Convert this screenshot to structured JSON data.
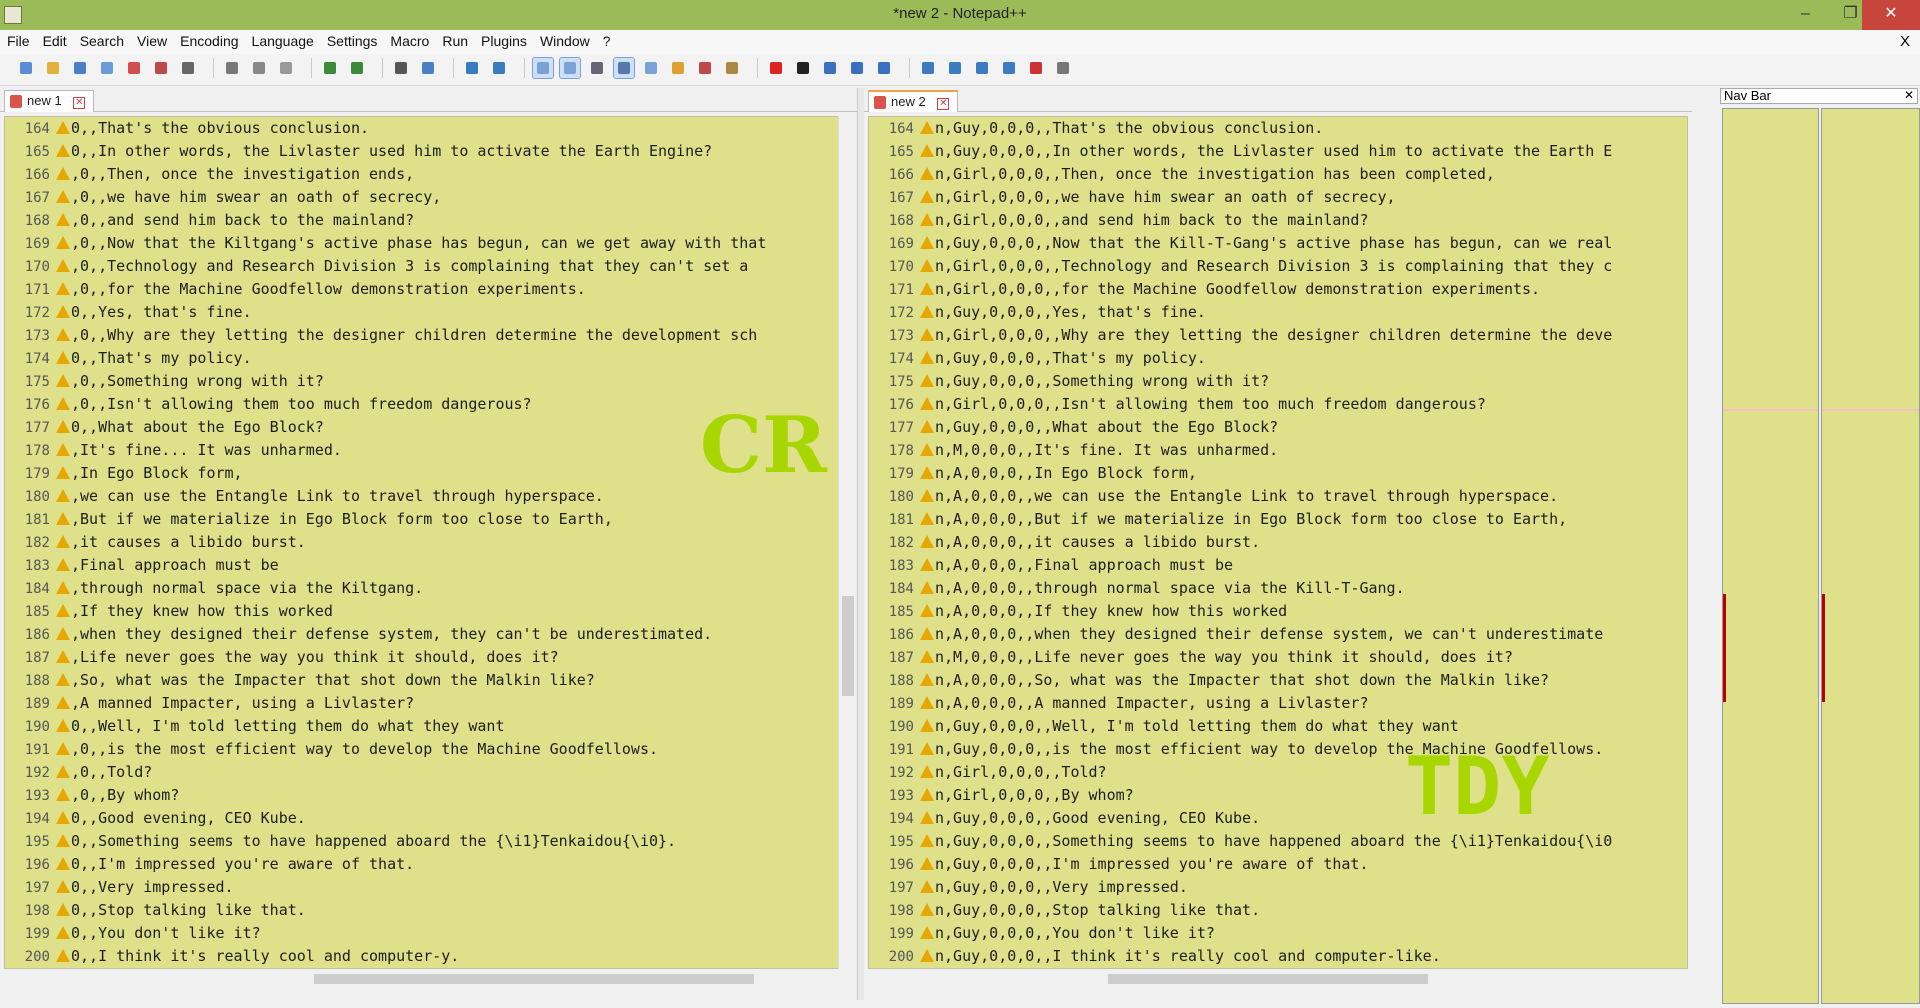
{
  "window": {
    "title": "*new  2 - Notepad++",
    "minimize": "–",
    "maximize": "❐",
    "close": "✕"
  },
  "menu": {
    "items": [
      "File",
      "Edit",
      "Search",
      "View",
      "Encoding",
      "Language",
      "Settings",
      "Macro",
      "Run",
      "Plugins",
      "Window",
      "?"
    ],
    "close_doc": "X"
  },
  "toolbar": {
    "icons": [
      "new-file-icon",
      "open-file-icon",
      "save-icon",
      "save-all-icon",
      "close-icon",
      "close-all-icon",
      "print-icon",
      "cut-icon",
      "copy-icon",
      "paste-icon",
      "undo-icon",
      "redo-icon",
      "find-icon",
      "replace-icon",
      "zoom-in-icon",
      "zoom-out-icon",
      "sync-vertical-icon",
      "sync-horizontal-icon",
      "word-wrap-icon",
      "show-all-chars-icon",
      "indent-guide-icon",
      "doc-map-icon",
      "function-list-icon",
      "folder-as-workspace-icon",
      "record-macro-icon",
      "stop-record-icon",
      "play-macro-icon",
      "run-macro-multiple-icon",
      "save-macro-icon",
      "first-icon",
      "up-icon",
      "down-icon",
      "last-icon",
      "spellcheck-icon",
      "compare-icon"
    ]
  },
  "left": {
    "tab": "new  1",
    "watermark": "CR",
    "lines": [
      {
        "n": "164",
        "t": "0,,That's the obvious conclusion."
      },
      {
        "n": "165",
        "t": "0,,In other words, the Livlaster used him to activate the Earth Engine?"
      },
      {
        "n": "166",
        "t": ",0,,Then, once the investigation ends,"
      },
      {
        "n": "167",
        "t": ",0,,we have him swear an oath of secrecy,"
      },
      {
        "n": "168",
        "t": ",0,,and send him back to the mainland?"
      },
      {
        "n": "169",
        "t": ",0,,Now that the Kiltgang's active phase has begun, can we get away with that"
      },
      {
        "n": "170",
        "t": ",0,,Technology and Research Division 3 is complaining that they can't set a"
      },
      {
        "n": "171",
        "t": ",0,,for the Machine Goodfellow demonstration experiments."
      },
      {
        "n": "172",
        "t": "0,,Yes, that's fine."
      },
      {
        "n": "173",
        "t": ",0,,Why are they letting the designer children determine the development sch"
      },
      {
        "n": "174",
        "t": "0,,That's my policy."
      },
      {
        "n": "175",
        "t": ",0,,Something wrong with it?"
      },
      {
        "n": "176",
        "t": ",0,,Isn't allowing them too much freedom dangerous?"
      },
      {
        "n": "177",
        "t": "0,,What about the Ego Block?"
      },
      {
        "n": "178",
        "t": ",It's fine... It was unharmed."
      },
      {
        "n": "179",
        "t": ",In Ego Block form,"
      },
      {
        "n": "180",
        "t": ",we can use the Entangle Link to travel through hyperspace."
      },
      {
        "n": "181",
        "t": ",But if we materialize in Ego Block form too close to Earth,"
      },
      {
        "n": "182",
        "t": ",it causes a libido burst."
      },
      {
        "n": "183",
        "t": ",Final approach must be"
      },
      {
        "n": "184",
        "t": ",through normal space via the Kiltgang."
      },
      {
        "n": "185",
        "t": ",If they knew how this worked"
      },
      {
        "n": "186",
        "t": ",when they designed their defense system, they can't be underestimated."
      },
      {
        "n": "187",
        "t": ",Life never goes the way you think it should, does it?"
      },
      {
        "n": "188",
        "t": ",So, what was the Impacter that shot down the Malkin like?"
      },
      {
        "n": "189",
        "t": ",A manned Impacter, using a Livlaster?"
      },
      {
        "n": "190",
        "t": "0,,Well, I'm told letting them do what they want"
      },
      {
        "n": "191",
        "t": ",0,,is the most efficient way to develop the Machine Goodfellows."
      },
      {
        "n": "192",
        "t": ",0,,Told?"
      },
      {
        "n": "193",
        "t": ",0,,By whom?"
      },
      {
        "n": "194",
        "t": "0,,Good evening, CEO Kube."
      },
      {
        "n": "195",
        "t": "0,,Something seems to have happened aboard the {\\i1}Tenkaidou{\\i0}."
      },
      {
        "n": "196",
        "t": "0,,I'm impressed you're aware of that."
      },
      {
        "n": "197",
        "t": "0,,Very impressed."
      },
      {
        "n": "198",
        "t": "0,,Stop talking like that."
      },
      {
        "n": "199",
        "t": "0,,You don't like it?"
      },
      {
        "n": "200",
        "t": "0,,I think it's really cool and computer-y."
      }
    ]
  },
  "right": {
    "tab": "new  2",
    "watermark": "TDY",
    "lines": [
      {
        "n": "164",
        "t": "n,Guy,0,0,0,,That's the obvious conclusion."
      },
      {
        "n": "165",
        "t": "n,Guy,0,0,0,,In other words, the Livlaster used him to activate the Earth E"
      },
      {
        "n": "166",
        "t": "n,Girl,0,0,0,,Then, once the investigation has been completed,"
      },
      {
        "n": "167",
        "t": "n,Girl,0,0,0,,we have him swear an oath of secrecy,"
      },
      {
        "n": "168",
        "t": "n,Girl,0,0,0,,and send him back to the mainland?"
      },
      {
        "n": "169",
        "t": "n,Guy,0,0,0,,Now that the Kill-T-Gang's active phase has begun, can we real"
      },
      {
        "n": "170",
        "t": "n,Girl,0,0,0,,Technology and Research Division 3 is complaining that they c"
      },
      {
        "n": "171",
        "t": "n,Girl,0,0,0,,for the Machine Goodfellow demonstration experiments."
      },
      {
        "n": "172",
        "t": "n,Guy,0,0,0,,Yes, that's fine."
      },
      {
        "n": "173",
        "t": "n,Girl,0,0,0,,Why are they letting the designer children determine the deve"
      },
      {
        "n": "174",
        "t": "n,Guy,0,0,0,,That's my policy."
      },
      {
        "n": "175",
        "t": "n,Guy,0,0,0,,Something wrong with it?"
      },
      {
        "n": "176",
        "t": "n,Girl,0,0,0,,Isn't allowing them too much freedom dangerous?"
      },
      {
        "n": "177",
        "t": "n,Guy,0,0,0,,What about the Ego Block?"
      },
      {
        "n": "178",
        "t": "n,M,0,0,0,,It's fine. It was unharmed."
      },
      {
        "n": "179",
        "t": "n,A,0,0,0,,In Ego Block form,"
      },
      {
        "n": "180",
        "t": "n,A,0,0,0,,we can use the Entangle Link to travel through hyperspace."
      },
      {
        "n": "181",
        "t": "n,A,0,0,0,,But if we materialize in Ego Block form too close to Earth,"
      },
      {
        "n": "182",
        "t": "n,A,0,0,0,,it causes a libido burst."
      },
      {
        "n": "183",
        "t": "n,A,0,0,0,,Final approach must be"
      },
      {
        "n": "184",
        "t": "n,A,0,0,0,,through normal space via the Kill-T-Gang."
      },
      {
        "n": "185",
        "t": "n,A,0,0,0,,If they knew how this worked"
      },
      {
        "n": "186",
        "t": "n,A,0,0,0,,when they designed their defense system, we can't underestimate"
      },
      {
        "n": "187",
        "t": "n,M,0,0,0,,Life never goes the way you think it should, does it?"
      },
      {
        "n": "188",
        "t": "n,A,0,0,0,,So, what was the Impacter that shot down the Malkin like?"
      },
      {
        "n": "189",
        "t": "n,A,0,0,0,,A manned Impacter, using a Livlaster?"
      },
      {
        "n": "190",
        "t": "n,Guy,0,0,0,,Well, I'm told letting them do what they want"
      },
      {
        "n": "191",
        "t": "n,Guy,0,0,0,,is the most efficient way to develop the Machine Goodfellows."
      },
      {
        "n": "192",
        "t": "n,Girl,0,0,0,,Told?"
      },
      {
        "n": "193",
        "t": "n,Girl,0,0,0,,By whom?"
      },
      {
        "n": "194",
        "t": "n,Guy,0,0,0,,Good evening, CEO Kube."
      },
      {
        "n": "195",
        "t": "n,Guy,0,0,0,,Something seems to have happened aboard the {\\i1}Tenkaidou{\\i0"
      },
      {
        "n": "196",
        "t": "n,Guy,0,0,0,,I'm impressed you're aware of that."
      },
      {
        "n": "197",
        "t": "n,Guy,0,0,0,,Very impressed."
      },
      {
        "n": "198",
        "t": "n,Guy,0,0,0,,Stop talking like that."
      },
      {
        "n": "199",
        "t": "n,Guy,0,0,0,,You don't like it?"
      },
      {
        "n": "200",
        "t": "n,Guy,0,0,0,,I think it's really cool and computer-like."
      }
    ]
  },
  "navbar": {
    "title": "Nav Bar",
    "close": "✕"
  },
  "colors": {
    "titlebar": "#9bbb59",
    "editor_bg": "#dfe08a",
    "watermark": "#a8d600"
  }
}
